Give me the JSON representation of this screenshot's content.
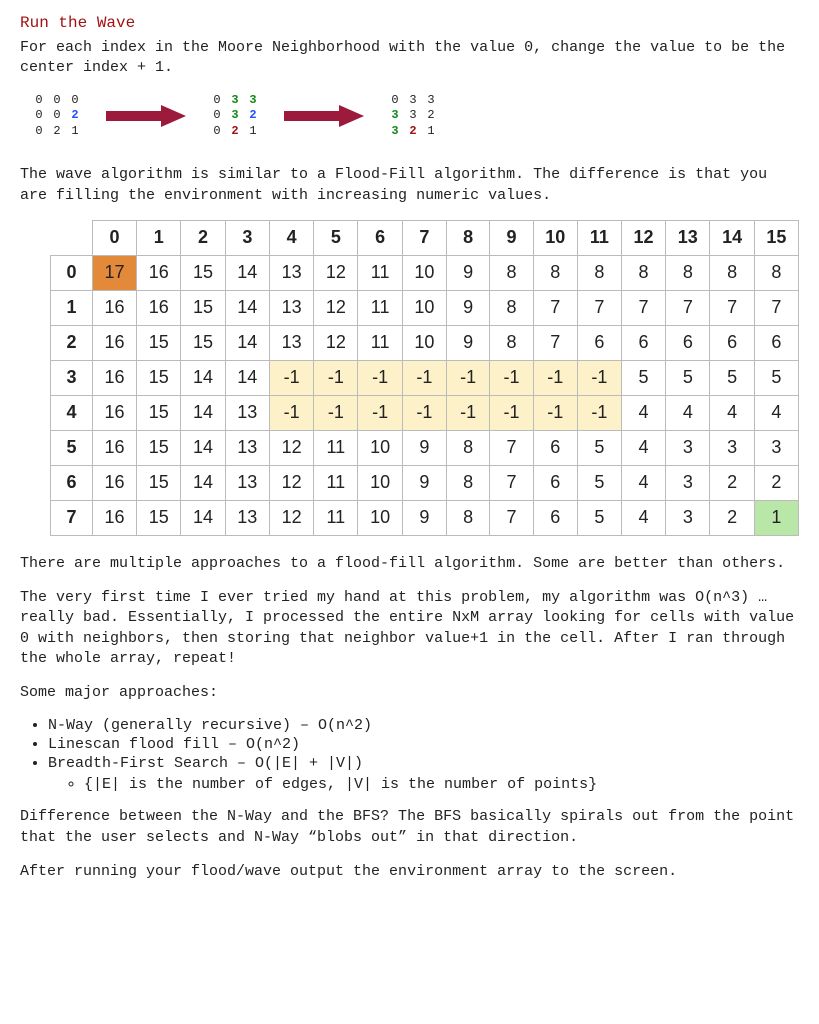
{
  "heading": "Run the Wave",
  "intro": "For each index in the Moore Neighborhood with the value 0, change the value to be the center index + 1.",
  "smallGrids": [
    {
      "rows": [
        {
          "cells": [
            {
              "v": "0"
            },
            {
              "v": "0"
            },
            {
              "v": "0"
            }
          ]
        },
        {
          "cells": [
            {
              "v": "0"
            },
            {
              "v": "0"
            },
            {
              "v": "2",
              "cls": "hl-blue"
            }
          ]
        },
        {
          "cells": [
            {
              "v": "0"
            },
            {
              "v": "2"
            },
            {
              "v": "1"
            }
          ]
        }
      ]
    },
    {
      "rows": [
        {
          "cells": [
            {
              "v": "0"
            },
            {
              "v": "3",
              "cls": "hl-green"
            },
            {
              "v": "3",
              "cls": "hl-green"
            }
          ]
        },
        {
          "cells": [
            {
              "v": "0"
            },
            {
              "v": "3",
              "cls": "hl-green"
            },
            {
              "v": "2",
              "cls": "hl-blue"
            }
          ]
        },
        {
          "cells": [
            {
              "v": "0"
            },
            {
              "v": "2",
              "cls": "hl-red"
            },
            {
              "v": "1"
            }
          ]
        }
      ]
    },
    {
      "rows": [
        {
          "cells": [
            {
              "v": "0"
            },
            {
              "v": "3"
            },
            {
              "v": "3"
            }
          ]
        },
        {
          "cells": [
            {
              "v": "3",
              "cls": "hl-green"
            },
            {
              "v": "3"
            },
            {
              "v": "2"
            }
          ]
        },
        {
          "cells": [
            {
              "v": "3",
              "cls": "hl-green"
            },
            {
              "v": "2",
              "cls": "hl-red"
            },
            {
              "v": "1"
            }
          ]
        }
      ]
    }
  ],
  "para2": "The wave algorithm is similar to a Flood-Fill algorithm.  The difference is that you are filling the environment with increasing numeric values.",
  "chart_data": {
    "type": "table",
    "title": "Wavefront grid",
    "cols": [
      "0",
      "1",
      "2",
      "3",
      "4",
      "5",
      "6",
      "7",
      "8",
      "9",
      "10",
      "11",
      "12",
      "13",
      "14",
      "15"
    ],
    "rows": [
      "0",
      "1",
      "2",
      "3",
      "4",
      "5",
      "6",
      "7"
    ],
    "cells": [
      [
        {
          "v": 17,
          "t": "start"
        },
        {
          "v": 16
        },
        {
          "v": 15
        },
        {
          "v": 14
        },
        {
          "v": 13
        },
        {
          "v": 12
        },
        {
          "v": 11
        },
        {
          "v": 10
        },
        {
          "v": 9
        },
        {
          "v": 8
        },
        {
          "v": 8
        },
        {
          "v": 8
        },
        {
          "v": 8
        },
        {
          "v": 8
        },
        {
          "v": 8
        },
        {
          "v": 8
        }
      ],
      [
        {
          "v": 16
        },
        {
          "v": 16
        },
        {
          "v": 15
        },
        {
          "v": 14
        },
        {
          "v": 13
        },
        {
          "v": 12
        },
        {
          "v": 11
        },
        {
          "v": 10
        },
        {
          "v": 9
        },
        {
          "v": 8
        },
        {
          "v": 7
        },
        {
          "v": 7
        },
        {
          "v": 7
        },
        {
          "v": 7
        },
        {
          "v": 7
        },
        {
          "v": 7
        }
      ],
      [
        {
          "v": 16
        },
        {
          "v": 15
        },
        {
          "v": 15
        },
        {
          "v": 14
        },
        {
          "v": 13
        },
        {
          "v": 12
        },
        {
          "v": 11
        },
        {
          "v": 10
        },
        {
          "v": 9
        },
        {
          "v": 8
        },
        {
          "v": 7
        },
        {
          "v": 6
        },
        {
          "v": 6
        },
        {
          "v": 6
        },
        {
          "v": 6
        },
        {
          "v": 6
        }
      ],
      [
        {
          "v": 16
        },
        {
          "v": 15
        },
        {
          "v": 14
        },
        {
          "v": 14
        },
        {
          "v": -1,
          "t": "wall"
        },
        {
          "v": -1,
          "t": "wall"
        },
        {
          "v": -1,
          "t": "wall"
        },
        {
          "v": -1,
          "t": "wall"
        },
        {
          "v": -1,
          "t": "wall"
        },
        {
          "v": -1,
          "t": "wall"
        },
        {
          "v": -1,
          "t": "wall"
        },
        {
          "v": -1,
          "t": "wall"
        },
        {
          "v": 5
        },
        {
          "v": 5
        },
        {
          "v": 5
        },
        {
          "v": 5
        }
      ],
      [
        {
          "v": 16
        },
        {
          "v": 15
        },
        {
          "v": 14
        },
        {
          "v": 13
        },
        {
          "v": -1,
          "t": "wall"
        },
        {
          "v": -1,
          "t": "wall"
        },
        {
          "v": -1,
          "t": "wall"
        },
        {
          "v": -1,
          "t": "wall"
        },
        {
          "v": -1,
          "t": "wall"
        },
        {
          "v": -1,
          "t": "wall"
        },
        {
          "v": -1,
          "t": "wall"
        },
        {
          "v": -1,
          "t": "wall"
        },
        {
          "v": 4
        },
        {
          "v": 4
        },
        {
          "v": 4
        },
        {
          "v": 4
        }
      ],
      [
        {
          "v": 16
        },
        {
          "v": 15
        },
        {
          "v": 14
        },
        {
          "v": 13
        },
        {
          "v": 12
        },
        {
          "v": 11
        },
        {
          "v": 10
        },
        {
          "v": 9
        },
        {
          "v": 8
        },
        {
          "v": 7
        },
        {
          "v": 6
        },
        {
          "v": 5
        },
        {
          "v": 4
        },
        {
          "v": 3
        },
        {
          "v": 3
        },
        {
          "v": 3
        }
      ],
      [
        {
          "v": 16
        },
        {
          "v": 15
        },
        {
          "v": 14
        },
        {
          "v": 13
        },
        {
          "v": 12
        },
        {
          "v": 11
        },
        {
          "v": 10
        },
        {
          "v": 9
        },
        {
          "v": 8
        },
        {
          "v": 7
        },
        {
          "v": 6
        },
        {
          "v": 5
        },
        {
          "v": 4
        },
        {
          "v": 3
        },
        {
          "v": 2
        },
        {
          "v": 2
        }
      ],
      [
        {
          "v": 16
        },
        {
          "v": 15
        },
        {
          "v": 14
        },
        {
          "v": 13
        },
        {
          "v": 12
        },
        {
          "v": 11
        },
        {
          "v": 10
        },
        {
          "v": 9
        },
        {
          "v": 8
        },
        {
          "v": 7
        },
        {
          "v": 6
        },
        {
          "v": 5
        },
        {
          "v": 4
        },
        {
          "v": 3
        },
        {
          "v": 2
        },
        {
          "v": 1,
          "t": "goal"
        }
      ]
    ]
  },
  "para3": "There are multiple approaches to a flood-fill algorithm.  Some are better than others.",
  "para4": "The very first time I ever tried my hand at this problem, my algorithm was O(n^3) … really bad.  Essentially, I processed the entire NxM array looking for cells with value 0 with neighbors, then storing that neighbor value+1 in the cell.  After I ran through the whole array, repeat!",
  "para5": "Some major approaches:",
  "approaches": [
    {
      "text": "N-Way (generally recursive) – O(n^2)"
    },
    {
      "text": "Linescan flood fill – O(n^2)"
    },
    {
      "text": "Breadth-First Search – O(|E| + |V|)",
      "sub": "{|E| is the number of edges, |V| is the number of points}"
    }
  ],
  "para6": "Difference between the N-Way and the BFS?  The BFS basically spirals out from the point that the user selects and N-Way “blobs out” in that direction.",
  "para7": "After running your flood/wave output the environment array to the screen."
}
